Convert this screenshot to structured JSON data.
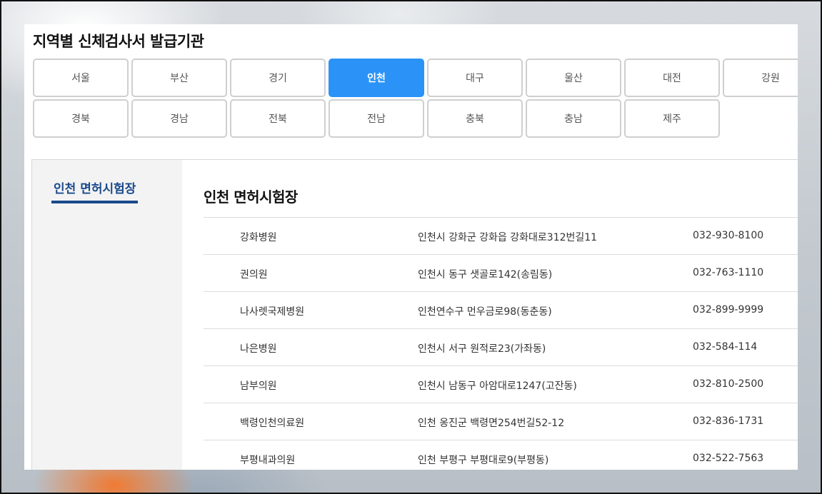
{
  "page": {
    "title": "지역별 신체검사서 발급기관"
  },
  "regions": [
    {
      "label": "서울",
      "active": false
    },
    {
      "label": "부산",
      "active": false
    },
    {
      "label": "경기",
      "active": false
    },
    {
      "label": "인천",
      "active": true
    },
    {
      "label": "대구",
      "active": false
    },
    {
      "label": "울산",
      "active": false
    },
    {
      "label": "대전",
      "active": false
    },
    {
      "label": "강원",
      "active": false
    },
    {
      "label": "경북",
      "active": false
    },
    {
      "label": "경남",
      "active": false
    },
    {
      "label": "전북",
      "active": false
    },
    {
      "label": "전남",
      "active": false
    },
    {
      "label": "충북",
      "active": false
    },
    {
      "label": "충남",
      "active": false
    },
    {
      "label": "제주",
      "active": false
    }
  ],
  "sidebar": {
    "items": [
      {
        "label": "인천 면허시험장",
        "active": true
      }
    ]
  },
  "main": {
    "section_title": "인천 면허시험장",
    "rows": [
      {
        "name": "강화병원",
        "address": "인천시 강화군 강화읍 강화대로312번길11",
        "phone": "032-930-8100"
      },
      {
        "name": "권의원",
        "address": "인천시 동구 샛골로142(송림동)",
        "phone": "032-763-1110"
      },
      {
        "name": "나사렛국제병원",
        "address": "인천연수구 먼우금로98(동춘동)",
        "phone": "032-899-9999"
      },
      {
        "name": "나은병원",
        "address": "인천시 서구 원적로23(가좌동)",
        "phone": "032-584-114"
      },
      {
        "name": "남부의원",
        "address": "인천시 남동구 아암대로1247(고잔동)",
        "phone": "032-810-2500"
      },
      {
        "name": "백령인천의료원",
        "address": "인천 옹진군 백령면254번길52-12",
        "phone": "032-836-1731"
      },
      {
        "name": "부평내과의원",
        "address": "인천 부평구 부평대로9(부평동)",
        "phone": "032-522-7563"
      }
    ]
  },
  "colors": {
    "accent": "#2b93f7",
    "sidebar_active": "#1a4a8c",
    "sidebar_bg": "#f3f3f3"
  }
}
